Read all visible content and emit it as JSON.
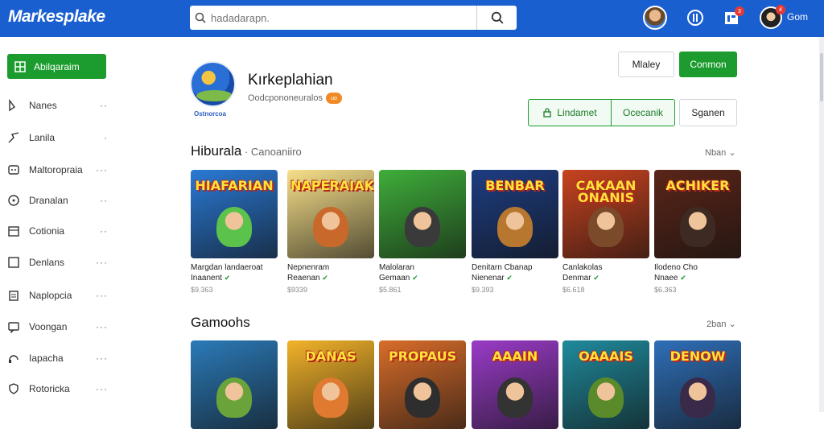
{
  "header": {
    "logo": "Markesplake",
    "search_placeholder": "hadadarapn.",
    "notif_count": "3",
    "msg_count": "4",
    "user_name": "Gom"
  },
  "sidebar": {
    "cta_label": "Abilqaraim",
    "items": [
      {
        "label": "Nanes",
        "icon": "tag-icon"
      },
      {
        "label": "Lanila",
        "icon": "arrow-icon"
      },
      {
        "label": "Maltoropraia",
        "icon": "gamepad-icon"
      },
      {
        "label": "Dranalan",
        "icon": "compass-icon"
      },
      {
        "label": "Cotionia",
        "icon": "calendar-icon"
      },
      {
        "label": "Denlans",
        "icon": "square-icon"
      },
      {
        "label": "Naplopcia",
        "icon": "clipboard-icon"
      },
      {
        "label": "Voongan",
        "icon": "message-icon"
      },
      {
        "label": "Iapacha",
        "icon": "headset-icon"
      },
      {
        "label": "Rotoricka",
        "icon": "shield-icon"
      }
    ]
  },
  "app": {
    "logo_caption": "Ostnorcoa",
    "title": "Kırkeplahian",
    "subtitle": "Oodcpononeuralos",
    "subtitle_badge": "uo",
    "btn_follow": "Mlaley",
    "btn_primary": "Conmon",
    "seg_install": "Lindamet",
    "seg_other": "Ocecanik",
    "btn_share": "Sganen"
  },
  "sections": [
    {
      "title": "Hiburala",
      "subtitle": "Canoaniiro",
      "more": "Nban",
      "cards": [
        {
          "img_title": "HIAFARIAN",
          "name1": "Margdan landaeroat",
          "name2": "Inaanent",
          "price": "$9.363",
          "bg": "#2a7ad6",
          "char": "#5bc24b"
        },
        {
          "img_title": "NAPERAIAK",
          "name1": "Nepnenram",
          "name2": "Reaenan",
          "price": "$9339",
          "bg": "#f7e08a",
          "char": "#c8682a"
        },
        {
          "img_title": "",
          "name1": "Malolaran",
          "name2": "Gemaan",
          "price": "$5.861",
          "bg": "#3fae3a",
          "char": "#3a3a3a"
        },
        {
          "img_title": "BENBAR",
          "name1": "Denitarn Cbanap",
          "name2": "Nienenar",
          "price": "$9.393",
          "bg": "#1d3d82",
          "char": "#b8772f"
        },
        {
          "img_title": "CAKAAN ONANIS",
          "name1": "Canlakolas",
          "name2": "Denmar",
          "price": "$6.618",
          "bg": "#c8431f",
          "char": "#7a4a2a"
        },
        {
          "img_title": "ACHIKER",
          "name1": "Ilodeno Cho",
          "name2": "Nnaee",
          "price": "$6.363",
          "bg": "#5a2518",
          "char": "#3d2a22"
        }
      ]
    },
    {
      "title": "Gamoohs",
      "subtitle": "",
      "more": "2ban",
      "cards": [
        {
          "img_title": "",
          "name1": "",
          "name2": "",
          "price": "",
          "bg": "#2b7ab8",
          "char": "#6aa33a"
        },
        {
          "img_title": "DANAS",
          "name1": "",
          "name2": "",
          "price": "",
          "bg": "#f2b329",
          "char": "#e07a30"
        },
        {
          "img_title": "PROPAUS",
          "name1": "",
          "name2": "",
          "price": "",
          "bg": "#d96d2a",
          "char": "#2e2e2e"
        },
        {
          "img_title": "AAAIN",
          "name1": "",
          "name2": "",
          "price": "",
          "bg": "#9a3bc8",
          "char": "#333"
        },
        {
          "img_title": "OAAAIS",
          "name1": "",
          "name2": "",
          "price": "",
          "bg": "#1f8a9c",
          "char": "#5b8a2a"
        },
        {
          "img_title": "DENOW",
          "name1": "",
          "name2": "",
          "price": "",
          "bg": "#2e6fb8",
          "char": "#3a2a4a"
        }
      ]
    }
  ],
  "colors": {
    "brand": "#1a5fd0",
    "accent": "#1c9c2e",
    "verified": "#1c9c2e"
  }
}
